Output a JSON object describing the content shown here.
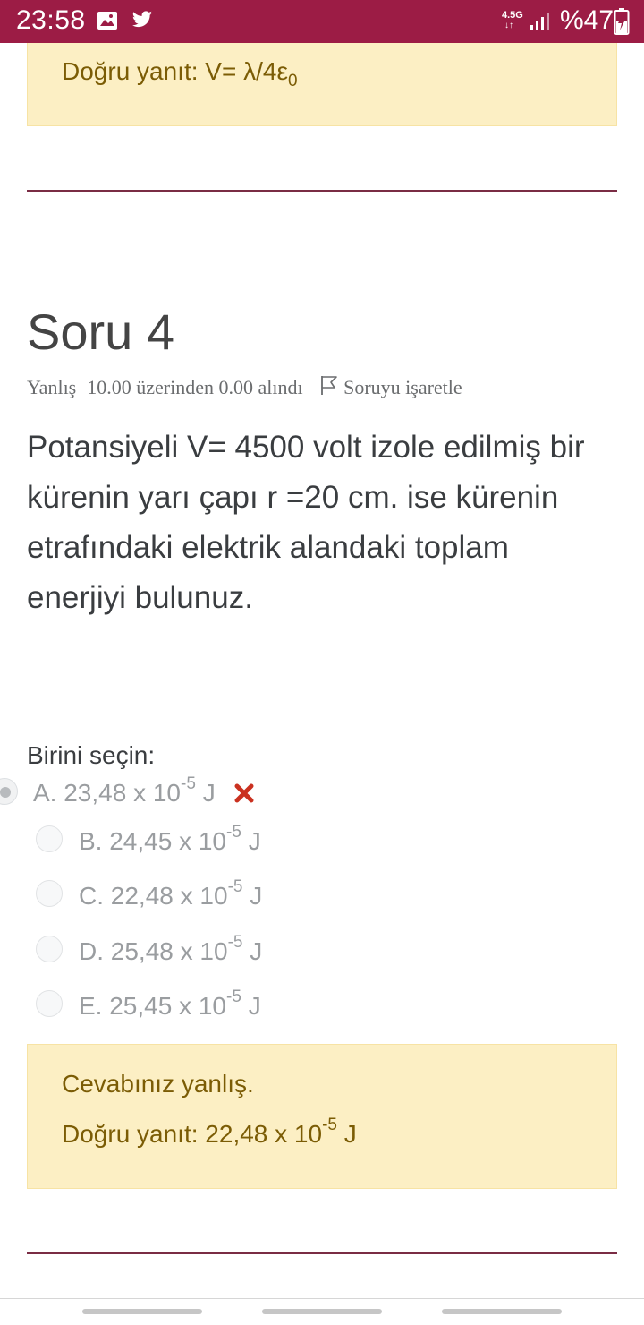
{
  "status_bar": {
    "time": "23:58",
    "network_label": "4.5G",
    "battery_text": "%47",
    "icons": [
      "gallery-icon",
      "twitter-icon",
      "signal-icon",
      "battery-icon"
    ],
    "background_color": "#9c1c45"
  },
  "previous_feedback": {
    "correct_answer_prefix": "Doğru yanıt: V= λ/4ε",
    "correct_answer_subscript": "0"
  },
  "question": {
    "title": "Soru 4",
    "status": "Yanlış",
    "grade": "10.00 üzerinden 0.00 alındı",
    "flag_label": "Soruyu işaretle",
    "text": "Potansiyeli V= 4500 volt izole edilmiş bir kürenin yarı çapı  r =20 cm. ise kürenin etrafındaki elektrik alandaki toplam enerjiyi bulunuz.",
    "prompt": "Birini seçin:",
    "options": [
      {
        "label": "A. 23,48 x 10",
        "exponent": "-5",
        "unit": " J",
        "selected": true,
        "marked_wrong": true
      },
      {
        "label": "B. 24,45 x 10",
        "exponent": "-5",
        "unit": " J",
        "selected": false
      },
      {
        "label": "C. 22,48 x 10",
        "exponent": "-5",
        "unit": " J",
        "selected": false
      },
      {
        "label": "D. 25,48 x 10",
        "exponent": "-5",
        "unit": " J",
        "selected": false
      },
      {
        "label": "E. 25,45 x 10",
        "exponent": "-5",
        "unit": " J",
        "selected": false
      }
    ]
  },
  "feedback": {
    "result": "Cevabınız yanlış.",
    "correct_answer_prefix": "Doğru yanıt: 22,48 x 10",
    "correct_answer_exponent": "-5",
    "correct_answer_unit": " J"
  },
  "colors": {
    "feedback_background": "#fcefc4",
    "feedback_text": "#7b5c05",
    "wrong_mark": "#ca3120",
    "divider": "#7a2c44"
  }
}
